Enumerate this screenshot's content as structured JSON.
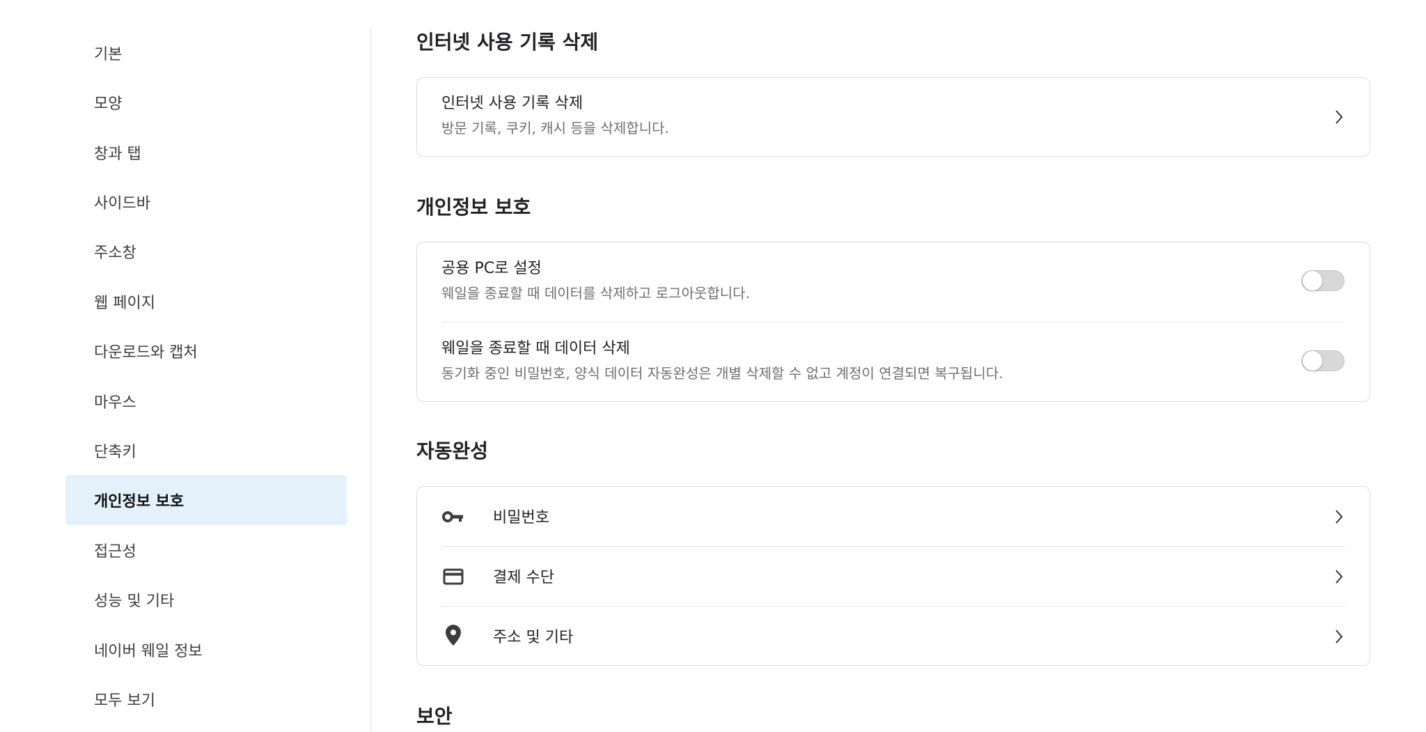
{
  "sidebar": {
    "items": [
      {
        "label": "기본"
      },
      {
        "label": "모양"
      },
      {
        "label": "창과 탭"
      },
      {
        "label": "사이드바"
      },
      {
        "label": "주소창"
      },
      {
        "label": "웹 페이지"
      },
      {
        "label": "다운로드와 캡처"
      },
      {
        "label": "마우스"
      },
      {
        "label": "단축키"
      },
      {
        "label": "개인정보 보호",
        "active": true
      },
      {
        "label": "접근성"
      },
      {
        "label": "성능 및 기타"
      },
      {
        "label": "네이버 웨일 정보"
      },
      {
        "label": "모두 보기"
      }
    ]
  },
  "sections": {
    "clear_history": {
      "title": "인터넷 사용 기록 삭제",
      "row": {
        "title": "인터넷 사용 기록 삭제",
        "desc": "방문 기록, 쿠키, 캐시 등을 삭제합니다."
      }
    },
    "privacy": {
      "title": "개인정보 보호",
      "rows": [
        {
          "title": "공용 PC로 설정",
          "desc": "웨일을 종료할 때 데이터를 삭제하고 로그아웃합니다.",
          "enabled": false
        },
        {
          "title": "웨일을 종료할 때 데이터 삭제",
          "desc": "동기화 중인 비밀번호, 양식 데이터 자동완성은 개별 삭제할 수 없고 계정이 연결되면 복구됩니다.",
          "enabled": false
        }
      ]
    },
    "autofill": {
      "title": "자동완성",
      "rows": [
        {
          "label": "비밀번호",
          "icon": "key-icon"
        },
        {
          "label": "결제 수단",
          "icon": "credit-card-icon"
        },
        {
          "label": "주소 및 기타",
          "icon": "location-pin-icon"
        }
      ]
    },
    "security": {
      "title": "보안"
    }
  },
  "colors": {
    "active_bg": "#e4f1fb",
    "toggle_off": "#d8d8d8"
  }
}
